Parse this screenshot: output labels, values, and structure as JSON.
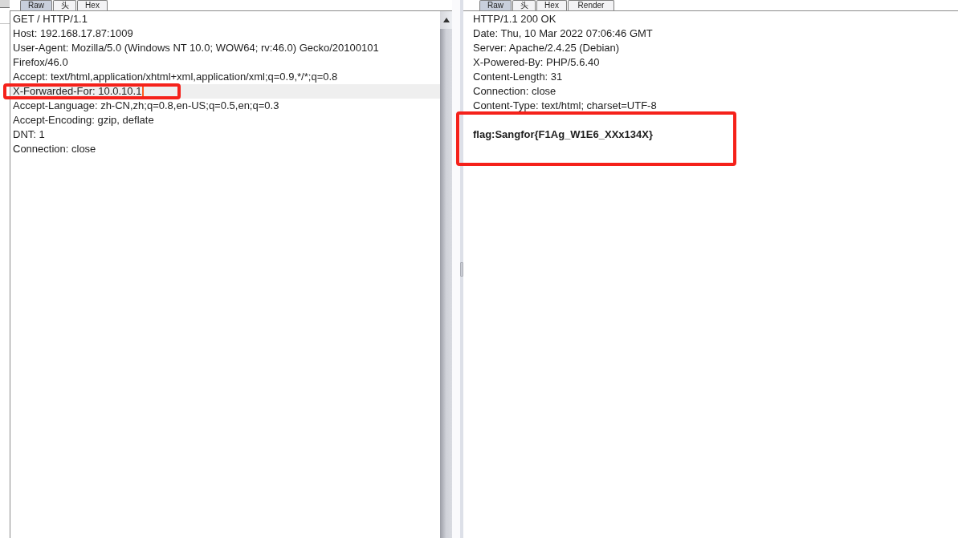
{
  "request": {
    "tabs": [
      {
        "label": "Raw",
        "selected": true
      },
      {
        "label": "头",
        "selected": false
      },
      {
        "label": "Hex",
        "selected": false
      }
    ],
    "lines": [
      {
        "text": "GET / HTTP/1.1",
        "current": false,
        "marked": false
      },
      {
        "text": "Host: 192.168.17.87:1009",
        "current": false,
        "marked": false
      },
      {
        "text": "User-Agent: Mozilla/5.0 (Windows NT 10.0; WOW64; rv:46.0) Gecko/20100101",
        "current": false,
        "marked": false
      },
      {
        "text": "Firefox/46.0",
        "current": false,
        "marked": false
      },
      {
        "text": "Accept: text/html,application/xhtml+xml,application/xml;q=0.9,*/*;q=0.8",
        "current": false,
        "marked": false
      },
      {
        "text": "X-Forwarded-For: 10.0.10.1",
        "current": true,
        "marked": true
      },
      {
        "text": "Accept-Language: zh-CN,zh;q=0.8,en-US;q=0.5,en;q=0.3",
        "current": false,
        "marked": false
      },
      {
        "text": "Accept-Encoding: gzip, deflate",
        "current": false,
        "marked": false
      },
      {
        "text": "DNT: 1",
        "current": false,
        "marked": false
      },
      {
        "text": "Connection: close",
        "current": false,
        "marked": false
      }
    ]
  },
  "response": {
    "tabs": [
      {
        "label": "Raw",
        "selected": true
      },
      {
        "label": "头",
        "selected": false
      },
      {
        "label": "Hex",
        "selected": false
      },
      {
        "label": "Render",
        "selected": false
      }
    ],
    "headers": [
      {
        "text": "HTTP/1.1 200 OK",
        "marked": false
      },
      {
        "text": "Date: Thu, 10 Mar 2022 07:06:46 GMT",
        "marked": false
      },
      {
        "text": "Server: Apache/2.4.25 (Debian)",
        "marked": false
      },
      {
        "text": "X-Powered-By: PHP/5.6.40",
        "marked": false
      },
      {
        "text": "Content-Length: 31",
        "marked": false
      },
      {
        "text": "Connection: close",
        "marked": false
      },
      {
        "text": "Content-Type: text/html; charset=UTF-8",
        "marked": false
      }
    ],
    "body": [
      {
        "text": "flag:Sangfor{F1Ag_W1E6_XXx134X}",
        "bold": true,
        "marked": true
      }
    ]
  }
}
